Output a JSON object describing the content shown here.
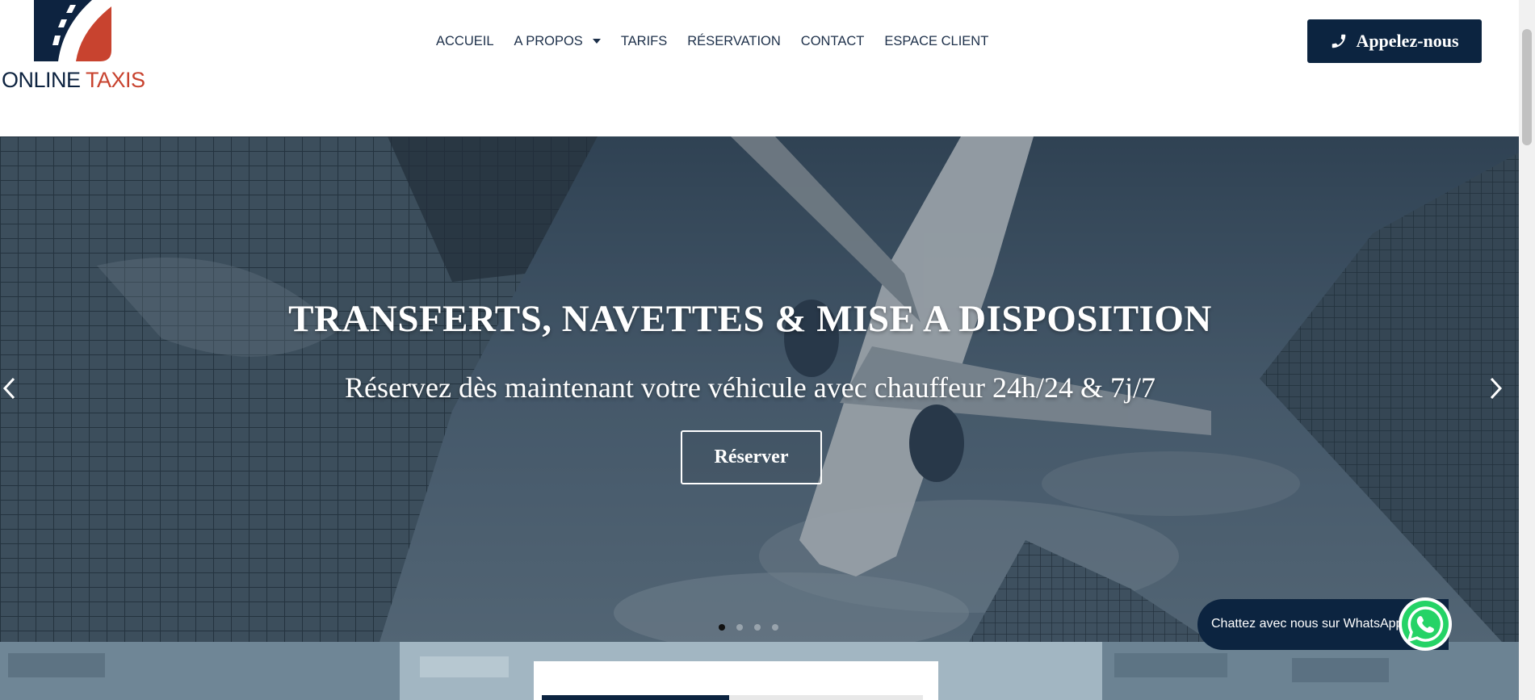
{
  "brand": {
    "word1": "ONLINE",
    "word2": "TAXIS",
    "navy": "#0d2340",
    "red": "#c8432f"
  },
  "nav": {
    "items": [
      {
        "label": "ACCUEIL"
      },
      {
        "label": "A PROPOS",
        "has_dropdown": true
      },
      {
        "label": "TARIFS"
      },
      {
        "label": "RÉSERVATION"
      },
      {
        "label": "CONTACT"
      },
      {
        "label": "ESPACE CLIENT"
      }
    ]
  },
  "call_button": {
    "label": "Appelez-nous",
    "icon": "phone-icon"
  },
  "hero": {
    "title": "TRANSFERTS, NAVETTES & MISE A DISPOSITION",
    "subtitle": "Réservez dès maintenant votre véhicule avec chauffeur 24h/24 & 7j/7",
    "cta": "Réserver",
    "slides_total": 4,
    "active_slide": 1
  },
  "whatsapp": {
    "label": "Chattez avec nous sur WhatsApp!",
    "icon": "whatsapp-icon"
  },
  "colors": {
    "accent": "#0c2440",
    "hero_overlay": "#3e5364"
  }
}
